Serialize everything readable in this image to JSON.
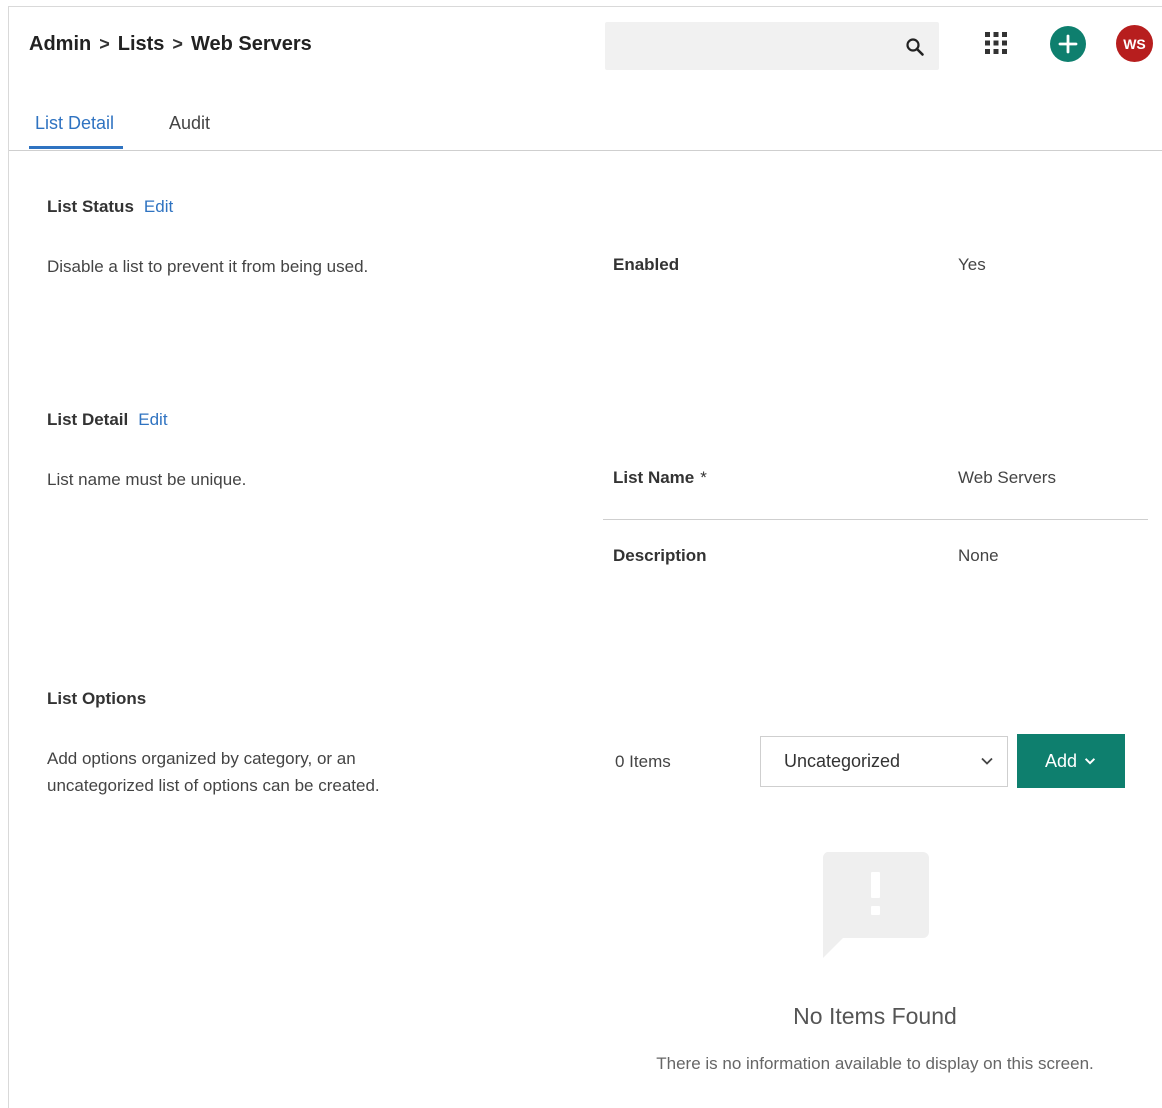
{
  "header": {
    "breadcrumb": [
      "Admin",
      "Lists",
      "Web Servers"
    ],
    "breadcrumb_separator": ">",
    "avatar_initials": "WS",
    "icons": [
      "search-icon",
      "apps-grid-icon",
      "plus-icon"
    ]
  },
  "tabs": [
    {
      "label": "List Detail",
      "active": true
    },
    {
      "label": "Audit",
      "active": false
    }
  ],
  "list_status": {
    "title": "List Status",
    "edit_label": "Edit",
    "description": "Disable a list to prevent it from being used.",
    "field_label": "Enabled",
    "field_value": "Yes"
  },
  "list_detail": {
    "title": "List Detail",
    "edit_label": "Edit",
    "description": "List name must be unique.",
    "name_label": "List Name",
    "required_mark": "*",
    "name_value": "Web Servers",
    "description_label": "Description",
    "description_value": "None"
  },
  "list_options": {
    "title": "List Options",
    "description_line1": "Add options organized by category, or an",
    "description_line2": "uncategorized list of options can be created.",
    "items_count": "0 Items",
    "category_select": "Uncategorized",
    "add_button": "Add"
  },
  "empty_state": {
    "title": "No Items Found",
    "text": "There is no information available to display on this screen."
  },
  "colors": {
    "accent": "#2f73c1",
    "primary_green": "#0e7f6e",
    "avatar_red": "#b71e1e"
  }
}
